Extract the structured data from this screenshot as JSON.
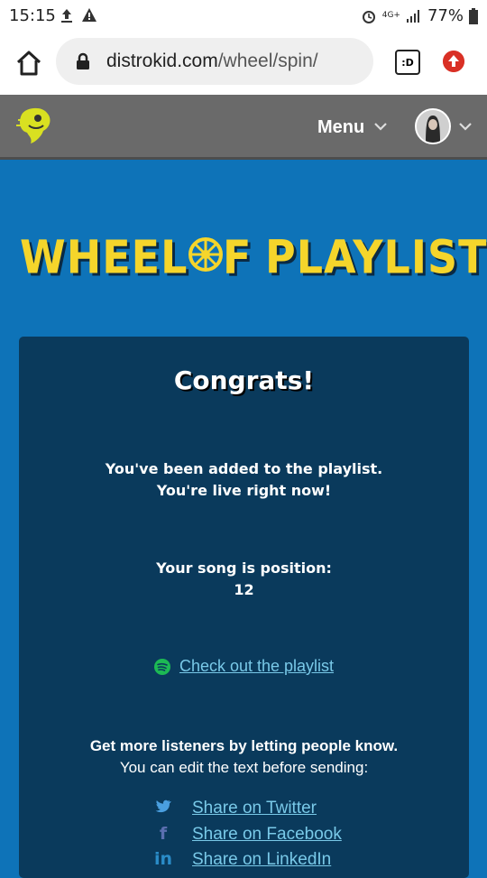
{
  "status_bar": {
    "time": "15:15",
    "network": "4G+",
    "battery": "77%"
  },
  "browser": {
    "url_domain": "distrokid.com",
    "url_path": "/wheel/spin/",
    "tabs_label": ":D"
  },
  "header": {
    "menu_label": "Menu"
  },
  "title": {
    "word1": "WHEEL",
    "word2": "F",
    "word3": "PLAYLIST"
  },
  "card": {
    "congrats": "Congrats!",
    "added_line1": "You've been added to the playlist.",
    "added_line2": "You're live right now!",
    "position_label": "Your song is position:",
    "position_value": "12",
    "playlist_link": "Check out the playlist",
    "share_intro_bold": "Get more listeners by letting people know.",
    "share_intro": "You can edit the text before sending:",
    "share_twitter": "Share on Twitter",
    "share_facebook": "Share on Facebook",
    "share_linkedin": "Share on LinkedIn"
  },
  "colors": {
    "background": "#0e73b8",
    "card": "#0a3a5c",
    "title_yellow": "#f5d52b",
    "link": "#79c9e8",
    "spotify": "#1db954"
  }
}
